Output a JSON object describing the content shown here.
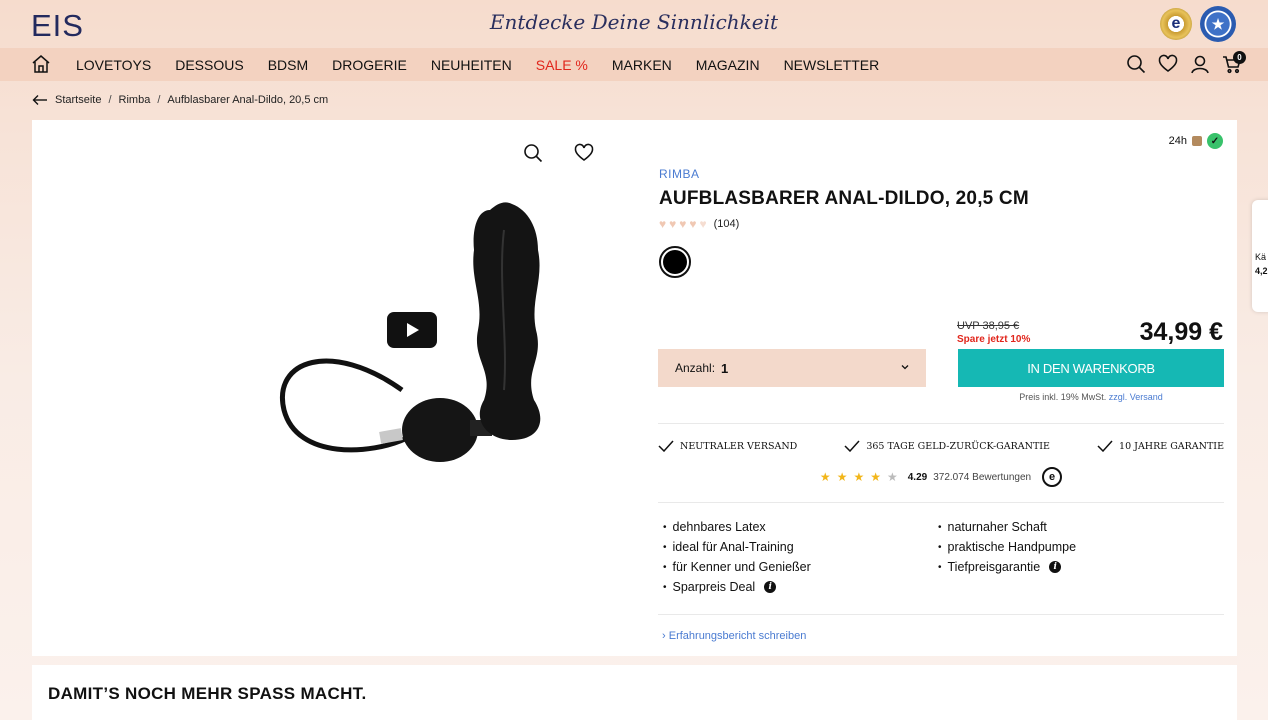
{
  "header": {
    "logo": "EIS",
    "tagline": "Entdecke Deine Sinnlichkeit",
    "seal_1": "e",
    "seal_2": "★"
  },
  "nav": {
    "items": [
      {
        "label": "LOVETOYS"
      },
      {
        "label": "DESSOUS"
      },
      {
        "label": "BDSM"
      },
      {
        "label": "DROGERIE"
      },
      {
        "label": "NEUHEITEN"
      },
      {
        "label": "SALE %"
      },
      {
        "label": "MARKEN"
      },
      {
        "label": "MAGAZIN"
      },
      {
        "label": "NEWSLETTER"
      }
    ],
    "cart_count": "0"
  },
  "breadcrumb": {
    "items": [
      "Startseite",
      "Rimba",
      "Aufblasbarer Anal-Dildo, 20,5 cm"
    ],
    "separator": "/"
  },
  "product": {
    "delivery": "24h",
    "brand": "RIMBA",
    "title": "AUFBLASBARER ANAL-DILDO, 20,5 CM",
    "rating_hearts": 4.5,
    "review_count": "(104)",
    "color": "#000000",
    "uvp": "UVP 38,95 €",
    "save": "Spare jetzt 10%",
    "price": "34,99 €",
    "qty_label": "Anzahl:",
    "qty_value": "1",
    "cart_button": "IN DEN WARENKORB",
    "vat_text": "Preis inkl. 19% MwSt.",
    "shipping_link": "zzgl. Versand"
  },
  "guarantees": [
    {
      "label": "Neutraler Versand"
    },
    {
      "label": "365 Tage Geld-zurück-Garantie"
    },
    {
      "label": "10 Jahre Garantie"
    }
  ],
  "trust": {
    "stars": 4.29,
    "score": "4.29",
    "count": "372.074 Bewertungen",
    "badge": "e"
  },
  "features": [
    {
      "text": "dehnbares Latex",
      "info": false
    },
    {
      "text": "naturnaher Schaft",
      "info": false
    },
    {
      "text": "ideal für Anal-Training",
      "info": false
    },
    {
      "text": "praktische Handpumpe",
      "info": false
    },
    {
      "text": "für Kenner und Genießer",
      "info": false
    },
    {
      "text": "Tiefpreisgarantie",
      "info": true
    },
    {
      "text": "Sparpreis Deal",
      "info": true
    }
  ],
  "review_link": "Erfahrungsbericht schreiben",
  "side_tab": {
    "label": "Kä",
    "value": "4,2"
  },
  "section2": {
    "title": "DAMIT’S NOCH MEHR SPASS MACHT."
  },
  "colors": {
    "accent_teal": "#15b8b4",
    "sale_red": "#e1261c",
    "link_blue": "#4a7bd1",
    "nav_bg": "#f3d2c0"
  }
}
